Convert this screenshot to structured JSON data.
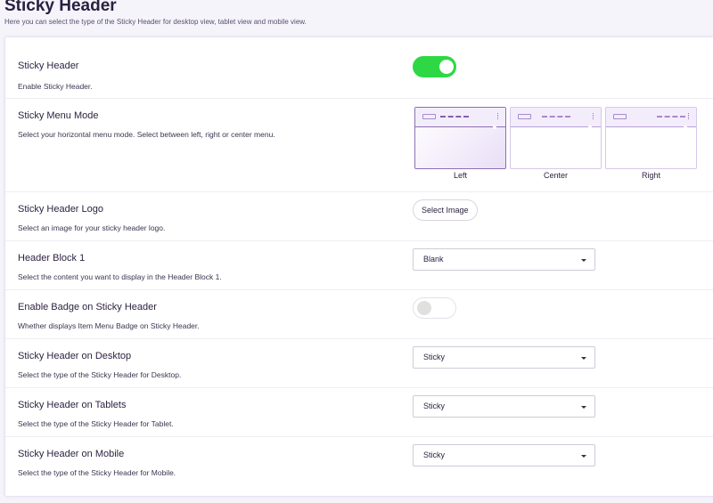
{
  "page": {
    "title": "Sticky Header",
    "subtitle": "Here you can select the type of the Sticky Header for desktop view, tablet view and mobile view."
  },
  "settings": [
    {
      "id": "sticky_header",
      "label": "Sticky Header",
      "description": "Enable Sticky Header.",
      "control": "toggle",
      "value": true
    },
    {
      "id": "sticky_menu_mode",
      "label": "Sticky Menu Mode",
      "description": "Select your horizontal menu mode. Select between left, right or center menu.",
      "control": "menu-mode",
      "options": [
        "Left",
        "Center",
        "Right"
      ],
      "selected": "Left"
    },
    {
      "id": "sticky_header_logo",
      "label": "Sticky Header Logo",
      "description": "Select an image for your sticky header logo.",
      "control": "button",
      "button_label": "Select Image"
    },
    {
      "id": "header_block_1",
      "label": "Header Block 1",
      "description": "Select the content you want to display in the Header Block 1.",
      "control": "select",
      "value": "Blank"
    },
    {
      "id": "enable_badge",
      "label": "Enable Badge on Sticky Header",
      "description": "Whether displays Item Menu Badge on Sticky Header.",
      "control": "toggle",
      "value": false
    },
    {
      "id": "sticky_desktop",
      "label": "Sticky Header on Desktop",
      "description": "Select the type of the Sticky Header for Desktop.",
      "control": "select",
      "value": "Sticky"
    },
    {
      "id": "sticky_tablets",
      "label": "Sticky Header on Tablets",
      "description": "Select the type of the Sticky Header for Tablet.",
      "control": "select",
      "value": "Sticky"
    },
    {
      "id": "sticky_mobile",
      "label": "Sticky Header on Mobile",
      "description": "Select the type of the Sticky Header for Mobile.",
      "control": "select",
      "value": "Sticky"
    }
  ],
  "colors": {
    "toggle_on": "#2ed844",
    "accent_purple": "#8d6fb3",
    "background": "#f6f4fb"
  }
}
